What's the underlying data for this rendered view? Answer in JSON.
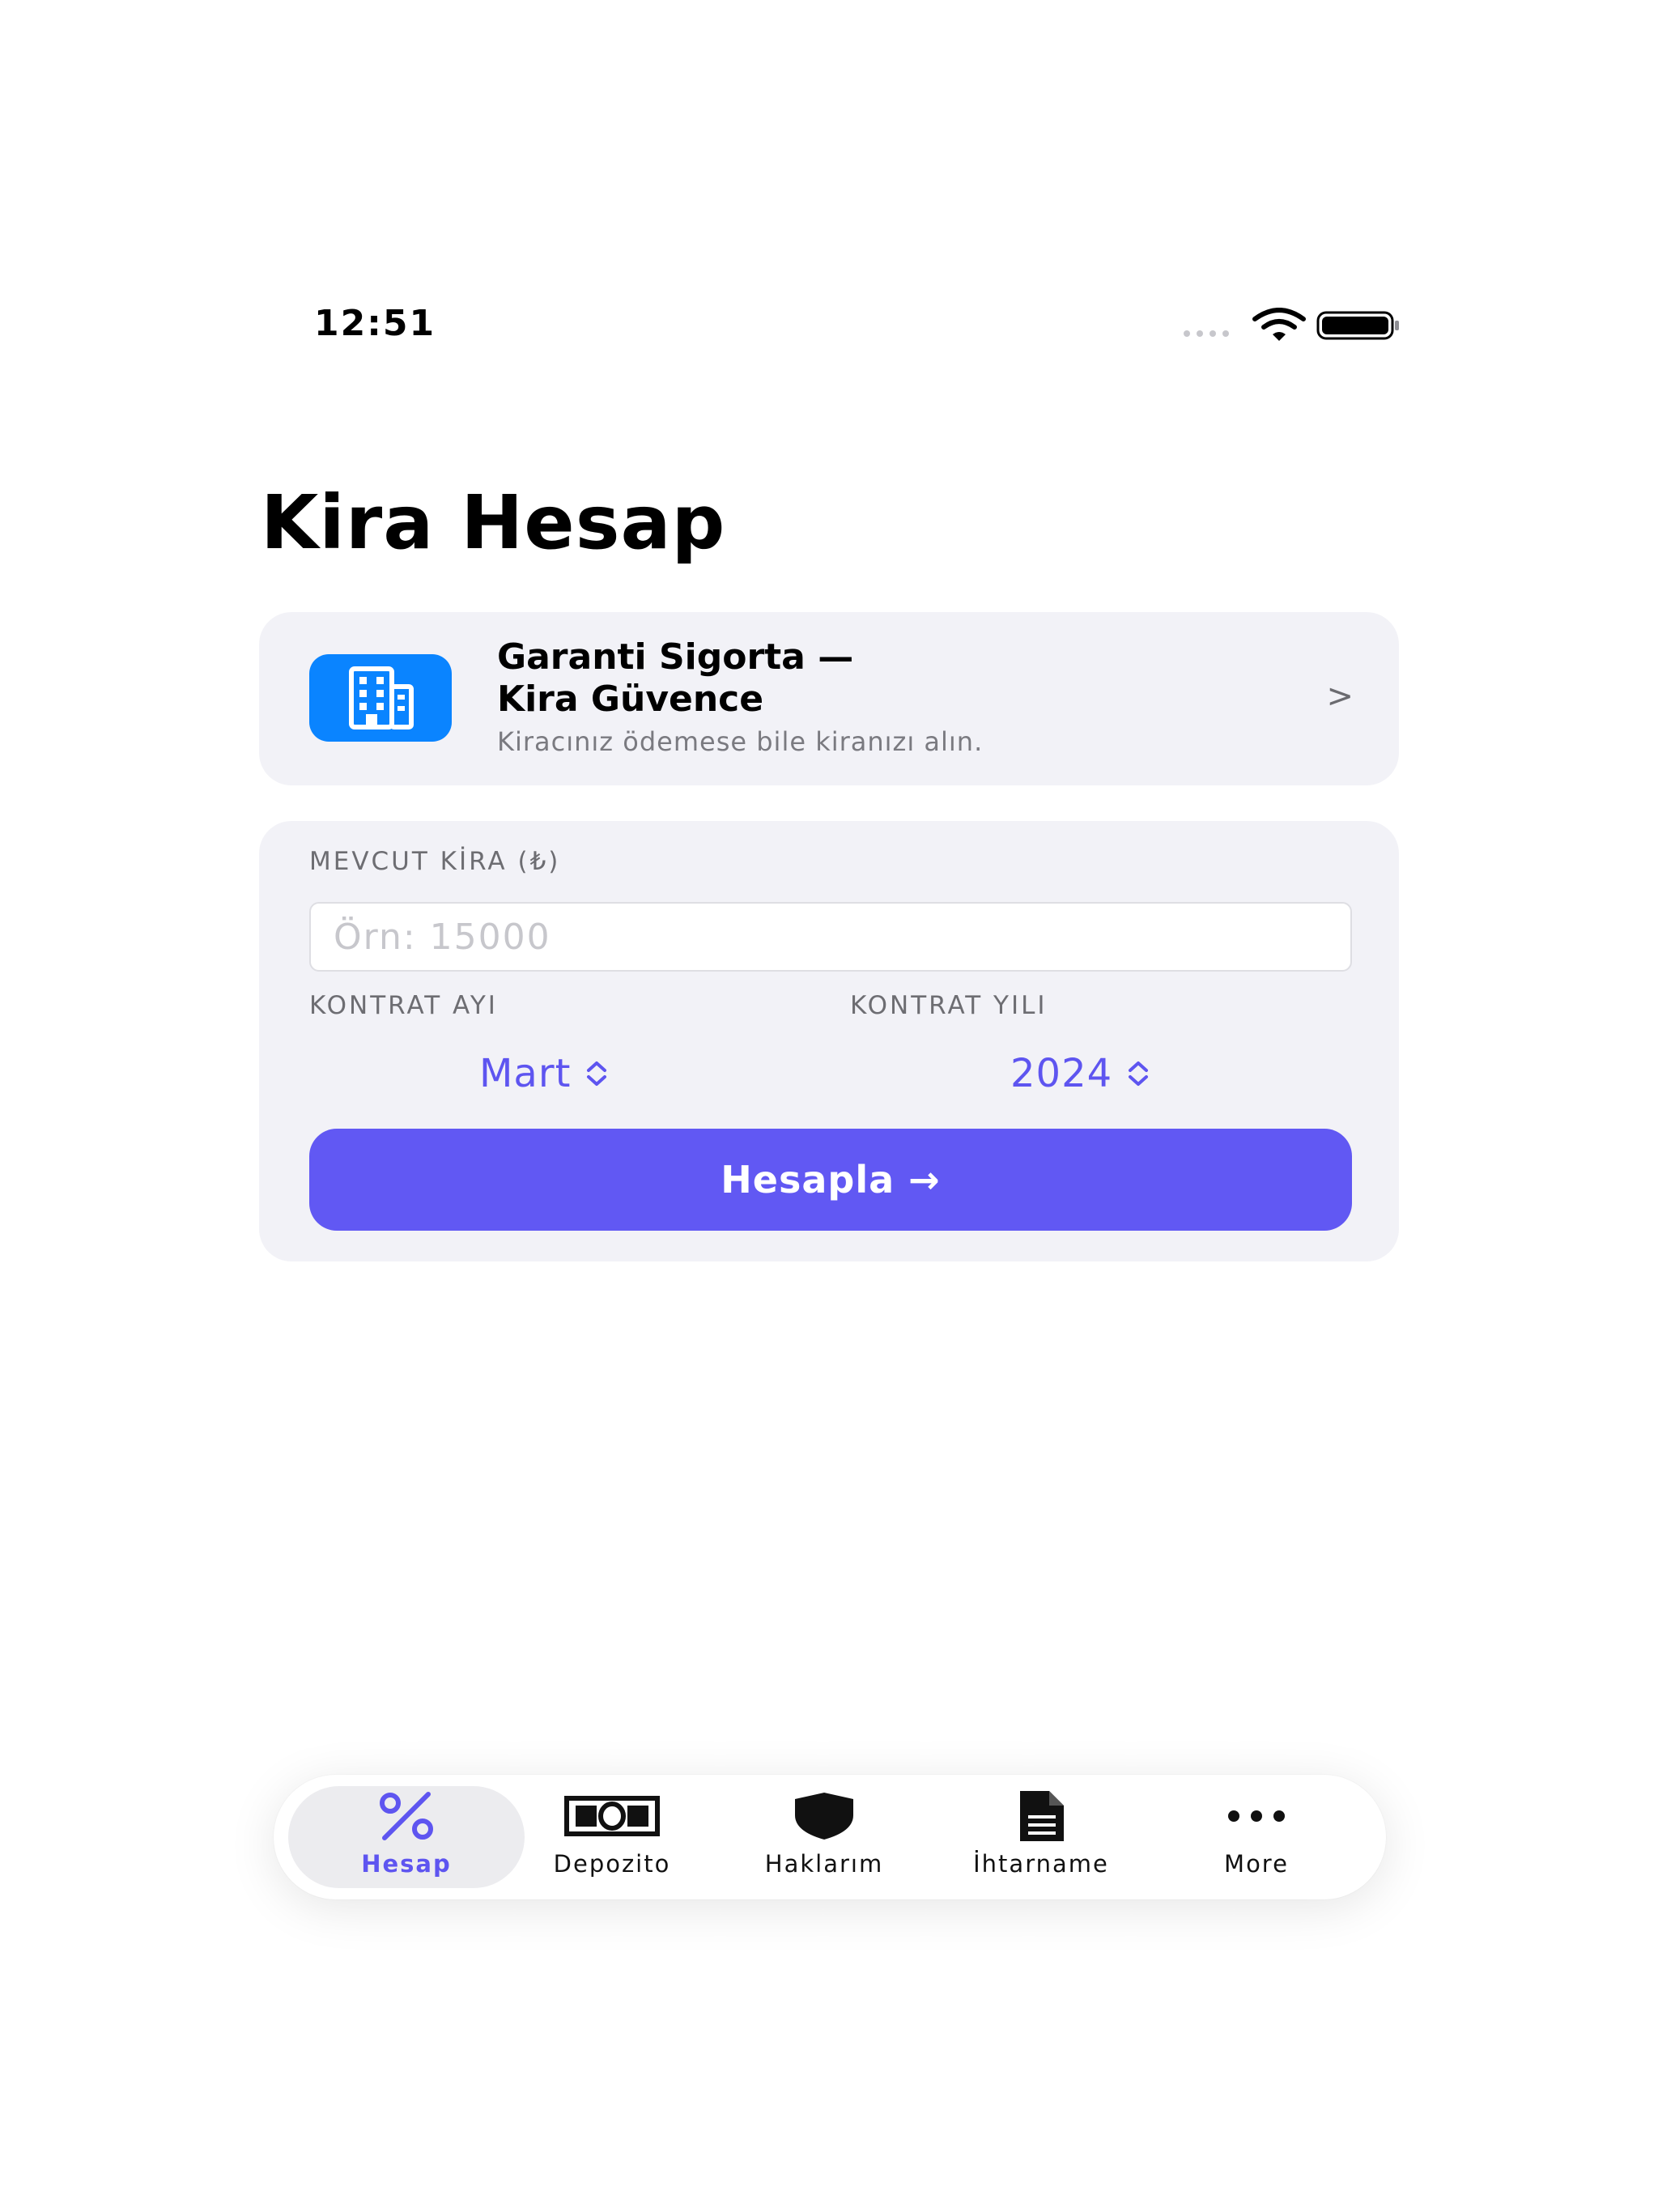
{
  "status_bar": {
    "time": "12:51"
  },
  "page": {
    "title": "Kira Hesap"
  },
  "promo": {
    "title": "Garanti Sigorta —\nKira Güvence",
    "subtitle": "Kiracınız ödemese bile kiranızı alın.",
    "chevron": ">"
  },
  "form": {
    "rent_label": "MEVCUT KİRA (₺)",
    "rent_value": "",
    "rent_placeholder": "Örn: 15000",
    "month_label": "KONTRAT AYI",
    "month_value": "Mart",
    "year_label": "KONTRAT YILI",
    "year_value": "2024",
    "calculate_label": "Hesapla →"
  },
  "tabs": [
    {
      "label": "Hesap",
      "icon": "percent-icon",
      "active": true
    },
    {
      "label": "Depozito",
      "icon": "banknote-icon",
      "active": false
    },
    {
      "label": "Haklarım",
      "icon": "shield-icon",
      "active": false
    },
    {
      "label": "İhtarname",
      "icon": "document-icon",
      "active": false
    },
    {
      "label": "More",
      "icon": "more-icon",
      "active": false
    }
  ],
  "colors": {
    "accent": "#6158f3",
    "picker_text": "#5e55f0",
    "promo_icon_bg": "#0a84ff",
    "card_bg": "#f2f2f7"
  }
}
